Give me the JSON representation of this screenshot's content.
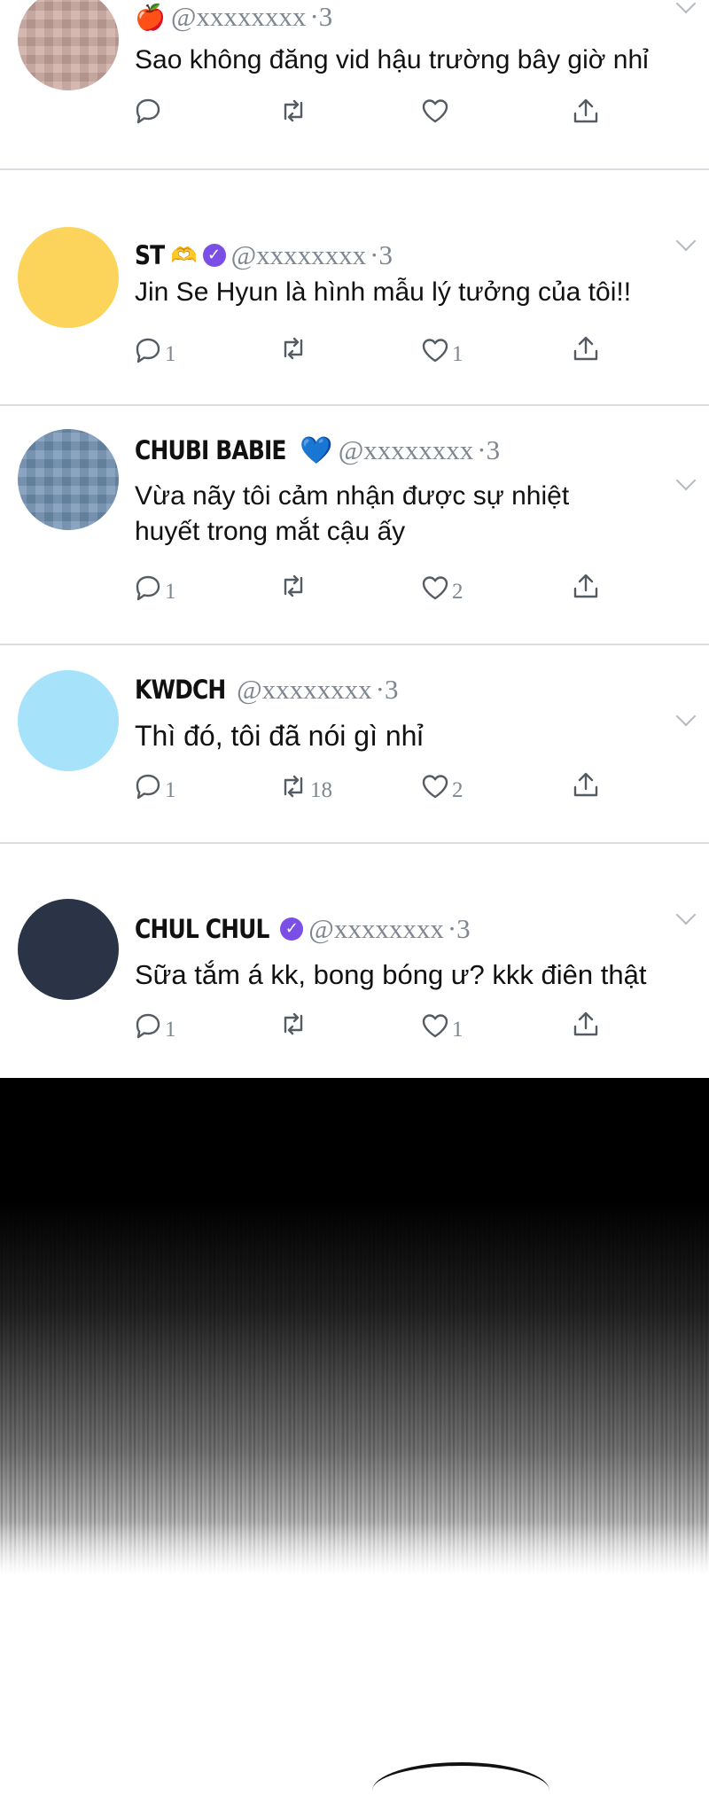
{
  "tweets": [
    {
      "name": "",
      "emoji": "🍎",
      "handle": "@xxxxxxxx",
      "time": "·3",
      "text": "Sao không đăng vid hậu trường bây giờ nhỉ",
      "replies": "",
      "retweets": "",
      "likes": "",
      "avatar_color": "#caa79e"
    },
    {
      "name": "ST",
      "hands": "🫶",
      "verified": "✓",
      "handle": "@xxxxxxxx",
      "time": "·3",
      "text": "Jin Se Hyun là hình mẫu lý tưởng của tôi!!",
      "replies": "1",
      "retweets": "",
      "likes": "1",
      "avatar_color": "#fdd45b"
    },
    {
      "name": "CHUBI BABIE",
      "heart": "💙",
      "handle": "@xxxxxxxx",
      "time": "·3",
      "text_line1": "Vừa nãy tôi cảm nhận được sự nhiệt",
      "text_line2": "huyết trong mắt cậu ấy",
      "replies": "1",
      "retweets": "",
      "likes": "2",
      "avatar_color": "#6f8fb0"
    },
    {
      "name": "KWDCH",
      "handle": "@xxxxxxxx",
      "time": "·3",
      "text": "Thì đó, tôi đã nói gì nhỉ",
      "replies": "1",
      "retweets": "18",
      "likes": "2",
      "avatar_color": "#a6e3fb"
    },
    {
      "name": "CHUL CHUL",
      "verified": "✓",
      "handle": "@xxxxxxxx",
      "time": "·3",
      "text": "Sữa tắm á kk, bong bóng ư? kkk điên thật",
      "replies": "1",
      "retweets": "",
      "likes": "1",
      "avatar_color": "#2b3346"
    }
  ],
  "icons": {
    "reply": "reply-icon",
    "retweet": "retweet-icon",
    "like": "heart-icon",
    "share": "share-icon",
    "more": "chevron-down-icon"
  }
}
